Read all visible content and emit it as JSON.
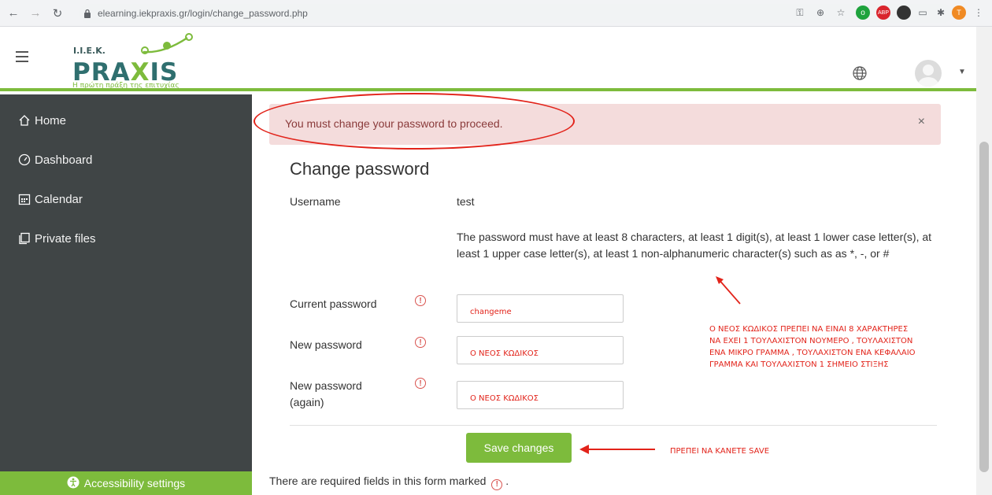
{
  "browser": {
    "url": "elearning.iekpraxis.gr/login/change_password.php"
  },
  "header": {
    "logo_top": "I.I.E.K.",
    "logo_main_a": "PRA",
    "logo_main_x": "X",
    "logo_main_b": "IS",
    "logo_slogan": "Η πρώτη πράξη της επιτυχίας"
  },
  "sidebar": {
    "items": [
      {
        "label": "Home",
        "icon": "home-icon"
      },
      {
        "label": "Dashboard",
        "icon": "dashboard-icon"
      },
      {
        "label": "Calendar",
        "icon": "calendar-icon"
      },
      {
        "label": "Private files",
        "icon": "files-icon"
      }
    ],
    "accessibility": "Accessibility settings"
  },
  "alert": {
    "text": "You must change your password to proceed.",
    "close": "×"
  },
  "form": {
    "title": "Change password",
    "username_label": "Username",
    "username_value": "test",
    "policy": "The password must have at least 8 characters, at least 1 digit(s), at least 1 lower case letter(s), at least 1 upper case letter(s), at least 1 non-alphanumeric character(s) such as as *, -, or #",
    "current_label": "Current password",
    "current_value": "changeme",
    "new_label": "New password",
    "new_value": "Ο ΝΕΟΣ ΚΩΔΙΚΟΣ",
    "again_label_1": "New password",
    "again_label_2": "(again)",
    "again_value": "Ο ΝΕΟΣ ΚΩΔΙΚΟΣ",
    "save_label": "Save changes",
    "required_note": "There are required fields in this form marked",
    "required_suffix": "."
  },
  "annotations": {
    "policy_note_lines": [
      "Ο ΝΕΟΣ ΚΩΔΙΚΟΣ ΠΡΕΠΕΙ ΝΑ ΕΙΝΑΙ 8 ΧΑΡΑΚΤΗΡΕΣ",
      "ΝΑ ΕΧΕΙ 1 ΤΟΥΛΑΧΙΣΤΟΝ ΝΟΥΜΕΡΟ , ΤΟΥΛΑΧΙΣΤΟΝ",
      "ΕΝΑ ΜΙΚΡΟ ΓΡΑΜΜΑ , ΤΟΥΛΑΧΙΣΤΟΝ ΕΝΑ ΚΕΦΑΛΑΙΟ",
      "ΓΡΑΜΜΑ ΚΑΙ ΤΟΥΛΑΧΙΣΤΟΝ 1 ΣΗΜΕΙΟ ΣΤΙΞΗΣ"
    ],
    "save_note": "ΠΡΕΠΕΙ ΝΑ ΚΑΝΕΤΕ SAVE"
  },
  "colors": {
    "accent": "#7dbb3c",
    "sidebar": "#404546",
    "alert_bg": "#f4dcdc",
    "annotation": "#e2231a"
  }
}
